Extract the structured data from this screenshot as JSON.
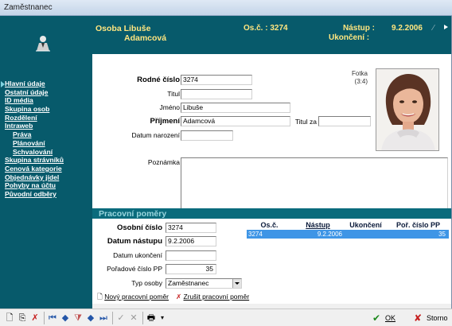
{
  "window": {
    "title": "Zaměstnanec"
  },
  "header": {
    "name_line1": "Osoba Libuše",
    "name_line2": "Adamcová",
    "osc_label": "Os.č. : 3274",
    "nastup_label": "Nástup :",
    "nastup_value": "9.2.2006",
    "ukonceni_label": "Ukončení :"
  },
  "sidebar": {
    "items": [
      {
        "label": "Hlavní údaje"
      },
      {
        "label": "Ostatní údaje"
      },
      {
        "label": "ID média"
      },
      {
        "label": "Skupina osob"
      },
      {
        "label": "Rozdělení"
      },
      {
        "label": "Intraweb"
      },
      {
        "label": "Práva"
      },
      {
        "label": "Plánování"
      },
      {
        "label": "Schvalování"
      },
      {
        "label": "Skupina strávníků"
      },
      {
        "label": "Cenová kategorie"
      },
      {
        "label": "Objednávky jídel"
      },
      {
        "label": "Pohyby na účtu"
      },
      {
        "label": "Původní odběry"
      }
    ]
  },
  "form": {
    "rodne_cislo": {
      "label": "Rodné číslo",
      "value": "3274"
    },
    "titul": {
      "label": "Titul",
      "value": ""
    },
    "jmeno": {
      "label": "Jméno",
      "value": "Libuše"
    },
    "prijmeni": {
      "label": "Příjmení",
      "value": "Adamcová"
    },
    "titul_za": {
      "label": "Titul za",
      "value": ""
    },
    "datum_narozeni": {
      "label": "Datum narození",
      "value": ""
    },
    "poznamka": {
      "label": "Poznámka",
      "value": ""
    },
    "fotka": {
      "label": "Fotka",
      "ratio": "(3:4)"
    }
  },
  "pracovni_pomery": {
    "title": "Pracovní poměry",
    "osobni_cislo": {
      "label": "Osobní číslo",
      "value": "3274"
    },
    "datum_nastupu": {
      "label": "Datum nástupu",
      "value": "9.2.2006"
    },
    "datum_ukonceni": {
      "label": "Datum ukončení",
      "value": ""
    },
    "poradove_cislo": {
      "label": "Pořadové číslo PP",
      "value": "35"
    },
    "typ_osoby": {
      "label": "Typ osoby",
      "value": "Zaměstnanec"
    },
    "grid": {
      "columns": [
        "Os.č.",
        "Nástup",
        "Ukončení",
        "Poř. číslo PP"
      ],
      "rows": [
        [
          "3274",
          "9.2.2006",
          "",
          "35"
        ]
      ]
    },
    "new_link": "Nový pracovní poměr",
    "cancel_link": "Zrušit pracovní poměr"
  },
  "toolbar": {
    "ok_label": "OK",
    "storno_label": "Storno"
  }
}
